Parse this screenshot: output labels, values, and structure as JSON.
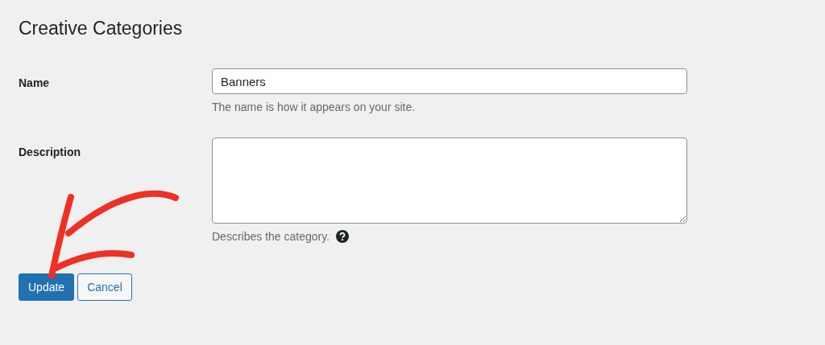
{
  "title": "Creative Categories",
  "fields": [
    {
      "kind": "input",
      "label": "Name",
      "value": "Banners",
      "hint": "The name is how it appears on your site.",
      "help": false
    },
    {
      "kind": "textarea",
      "label": "Description",
      "hint": "Describes the category.",
      "help": true
    }
  ],
  "buttons": [
    {
      "label": "Update",
      "kind": "primary"
    },
    {
      "label": "Cancel",
      "kind": "secondary"
    }
  ]
}
